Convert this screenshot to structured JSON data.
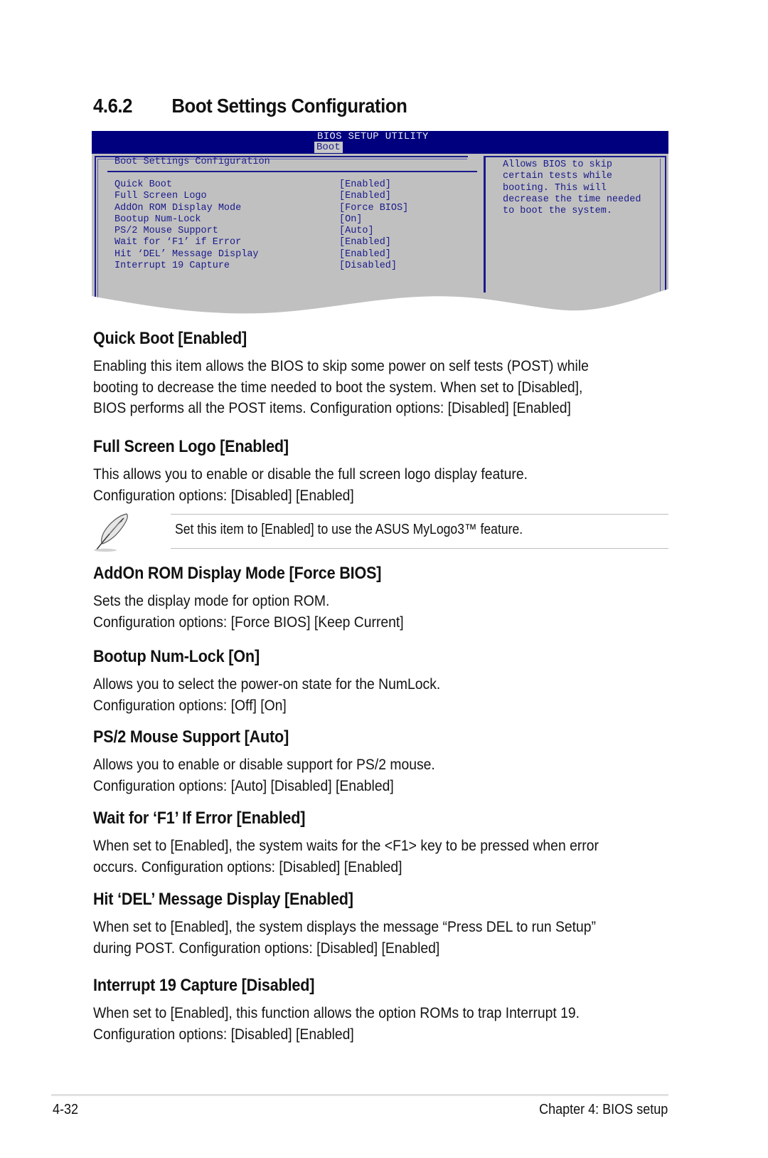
{
  "section": {
    "number": "4.6.2",
    "title": "Boot Settings Configuration"
  },
  "bios": {
    "header_title": "BIOS SETUP UTILITY",
    "active_tab": "Boot",
    "panel_title": "Boot Settings Configuration",
    "items": [
      {
        "label": "Quick Boot",
        "value": "[Enabled]"
      },
      {
        "label": "Full Screen Logo",
        "value": "[Enabled]"
      },
      {
        "label": "AddOn ROM Display Mode",
        "value": "[Force BIOS]"
      },
      {
        "label": "Bootup Num-Lock",
        "value": "[On]"
      },
      {
        "label": "PS/2 Mouse Support",
        "value": "[Auto]"
      },
      {
        "label": "Wait for ‘F1’ if Error",
        "value": "[Enabled]"
      },
      {
        "label": "Hit ‘DEL’ Message Display",
        "value": "[Enabled]"
      },
      {
        "label": "Interrupt 19 Capture",
        "value": "[Disabled]"
      }
    ],
    "help_lines": [
      "Allows BIOS to skip",
      "certain tests while",
      "booting. This will",
      "decrease the time needed",
      "to boot the system."
    ],
    "colors": {
      "header": "#00007f",
      "panel": "#c0c0c0",
      "text": "#1a1a8c"
    }
  },
  "sections": [
    {
      "heading": "Quick Boot [Enabled]",
      "lines": [
        "Enabling this item allows the BIOS to skip some power on self tests (POST) while",
        "booting to decrease the time needed to boot the system. When set to [Disabled],",
        "BIOS performs all the POST items. Configuration options: [Disabled] [Enabled]"
      ]
    },
    {
      "heading": "Full Screen Logo [Enabled]",
      "lines": [
        "This allows you to enable or disable the full screen logo display feature.",
        "Configuration options: [Disabled] [Enabled]"
      ]
    },
    {
      "heading": "AddOn ROM Display Mode [Force BIOS]",
      "lines": [
        "Sets the display mode for option ROM.",
        "Configuration options: [Force BIOS] [Keep Current]"
      ]
    },
    {
      "heading": "Bootup Num-Lock [On]",
      "lines": [
        "Allows you to select the power-on state for the NumLock.",
        "Configuration options: [Off] [On]"
      ]
    },
    {
      "heading": "PS/2 Mouse Support [Auto]",
      "lines": [
        "Allows you to enable or disable support for PS/2 mouse.",
        "Configuration options: [Auto] [Disabled] [Enabled]"
      ]
    },
    {
      "heading": "Wait for ‘F1’ If Error [Enabled]",
      "lines": [
        "When set to [Enabled], the system waits for the <F1> key to be pressed when error",
        "occurs. Configuration options: [Disabled] [Enabled]"
      ]
    },
    {
      "heading": "Hit ‘DEL’ Message Display [Enabled]",
      "lines": [
        "When set to [Enabled], the system displays the message “Press DEL to run Setup”",
        "during POST. Configuration options: [Disabled] [Enabled]"
      ]
    },
    {
      "heading": "Interrupt 19 Capture [Disabled]",
      "lines": [
        "When set to [Enabled], this function allows the option ROMs to trap Interrupt 19.",
        "Configuration options: [Disabled] [Enabled]"
      ]
    }
  ],
  "note": {
    "icon": "feather-quill-icon",
    "text": "Set this item to [Enabled] to use the ASUS MyLogo3™ feature."
  },
  "footer": {
    "page_number": "4-32",
    "chapter": "Chapter 4: BIOS setup"
  }
}
